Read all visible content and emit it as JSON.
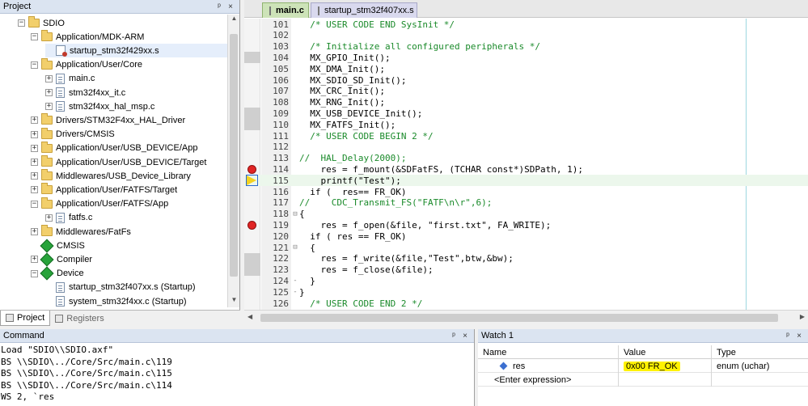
{
  "project_panel": {
    "title": "Project",
    "pin": "ᵖ",
    "close": "×",
    "tree": [
      {
        "label": "SDIO",
        "kind": "folder",
        "indent": 1,
        "exp": "−",
        "sel": false
      },
      {
        "label": "Application/MDK-ARM",
        "kind": "folder",
        "indent": 2,
        "exp": "−",
        "sel": false
      },
      {
        "label": "startup_stm32f429xx.s",
        "kind": "asm",
        "indent": 3,
        "exp": "",
        "sel": true
      },
      {
        "label": "Application/User/Core",
        "kind": "folder",
        "indent": 2,
        "exp": "−",
        "sel": false
      },
      {
        "label": "main.c",
        "kind": "file",
        "indent": 3,
        "exp": "+",
        "sel": false
      },
      {
        "label": "stm32f4xx_it.c",
        "kind": "file",
        "indent": 3,
        "exp": "+",
        "sel": false
      },
      {
        "label": "stm32f4xx_hal_msp.c",
        "kind": "file",
        "indent": 3,
        "exp": "+",
        "sel": false
      },
      {
        "label": "Drivers/STM32F4xx_HAL_Driver",
        "kind": "folder",
        "indent": 2,
        "exp": "+",
        "sel": false
      },
      {
        "label": "Drivers/CMSIS",
        "kind": "folder",
        "indent": 2,
        "exp": "+",
        "sel": false
      },
      {
        "label": "Application/User/USB_DEVICE/App",
        "kind": "folder",
        "indent": 2,
        "exp": "+",
        "sel": false
      },
      {
        "label": "Application/User/USB_DEVICE/Target",
        "kind": "folder",
        "indent": 2,
        "exp": "+",
        "sel": false
      },
      {
        "label": "Middlewares/USB_Device_Library",
        "kind": "folder",
        "indent": 2,
        "exp": "+",
        "sel": false
      },
      {
        "label": "Application/User/FATFS/Target",
        "kind": "folder",
        "indent": 2,
        "exp": "+",
        "sel": false
      },
      {
        "label": "Application/User/FATFS/App",
        "kind": "folder",
        "indent": 2,
        "exp": "−",
        "sel": false
      },
      {
        "label": "fatfs.c",
        "kind": "file",
        "indent": 3,
        "exp": "+",
        "sel": false
      },
      {
        "label": "Middlewares/FatFs",
        "kind": "folder",
        "indent": 2,
        "exp": "+",
        "sel": false
      },
      {
        "label": "CMSIS",
        "kind": "gem",
        "indent": 2,
        "exp": "",
        "sel": false
      },
      {
        "label": "Compiler",
        "kind": "gem",
        "indent": 2,
        "exp": "+",
        "sel": false
      },
      {
        "label": "Device",
        "kind": "gem",
        "indent": 2,
        "exp": "−",
        "sel": false
      },
      {
        "label": "startup_stm32f407xx.s (Startup)",
        "kind": "file",
        "indent": 3,
        "exp": "",
        "sel": false
      },
      {
        "label": "system_stm32f4xx.c (Startup)",
        "kind": "file",
        "indent": 3,
        "exp": "",
        "sel": false
      }
    ],
    "bottom_tabs": [
      "Project",
      "Registers"
    ]
  },
  "editor": {
    "tabs": [
      "main.c",
      "startup_stm32f407xx.s"
    ],
    "lines": [
      {
        "n": "101",
        "text": "  /* USER CODE END SysInit */",
        "cls": "cm",
        "fold": "",
        "mark": "",
        "gray": false
      },
      {
        "n": "102",
        "text": "",
        "cls": "",
        "fold": "",
        "mark": "",
        "gray": false
      },
      {
        "n": "103",
        "text": "  /* Initialize all configured peripherals */",
        "cls": "cm",
        "fold": "",
        "mark": "",
        "gray": false
      },
      {
        "n": "104",
        "text": "  MX_GPIO_Init();",
        "cls": "",
        "fold": "",
        "mark": "",
        "gray": true
      },
      {
        "n": "105",
        "text": "  MX_DMA_Init();",
        "cls": "",
        "fold": "",
        "mark": "",
        "gray": false
      },
      {
        "n": "106",
        "text": "  MX_SDIO_SD_Init();",
        "cls": "",
        "fold": "",
        "mark": "",
        "gray": false
      },
      {
        "n": "107",
        "text": "  MX_CRC_Init();",
        "cls": "",
        "fold": "",
        "mark": "",
        "gray": false
      },
      {
        "n": "108",
        "text": "  MX_RNG_Init();",
        "cls": "",
        "fold": "",
        "mark": "",
        "gray": false
      },
      {
        "n": "109",
        "text": "  MX_USB_DEVICE_Init();",
        "cls": "",
        "fold": "",
        "mark": "",
        "gray": true
      },
      {
        "n": "110",
        "text": "  MX_FATFS_Init();",
        "cls": "",
        "fold": "",
        "mark": "",
        "gray": true
      },
      {
        "n": "111",
        "text": "  /* USER CODE BEGIN 2 */",
        "cls": "cm",
        "fold": "",
        "mark": "",
        "gray": false
      },
      {
        "n": "112",
        "text": "",
        "cls": "",
        "fold": "",
        "mark": "",
        "gray": false
      },
      {
        "n": "113",
        "text": "//  HAL_Delay(2000);",
        "cls": "cm",
        "fold": "",
        "mark": "",
        "gray": false
      },
      {
        "n": "114",
        "text": "    res = f_mount(&SDFatFS, (TCHAR const*)SDPath, 1);",
        "cls": "",
        "fold": "",
        "mark": "bp",
        "gray": false
      },
      {
        "n": "115",
        "text": "    printf(\"Test\");",
        "cls": "",
        "fold": "",
        "mark": "pc",
        "gray": false,
        "current": true
      },
      {
        "n": "116",
        "text": "  if (  res== FR_OK)",
        "cls": "",
        "fold": "",
        "mark": "",
        "gray": false
      },
      {
        "n": "117",
        "text": "//    CDC_Transmit_FS(\"FATF\\n\\r\",6);",
        "cls": "cm",
        "fold": "",
        "mark": "",
        "gray": false
      },
      {
        "n": "118",
        "text": "{",
        "cls": "",
        "fold": "⊟",
        "mark": "",
        "gray": false
      },
      {
        "n": "119",
        "text": "    res = f_open(&file, \"first.txt\", FA_WRITE);",
        "cls": "",
        "fold": "",
        "mark": "bp",
        "gray": false
      },
      {
        "n": "120",
        "text": "  if ( res == FR_OK)",
        "cls": "",
        "fold": "",
        "mark": "",
        "gray": false
      },
      {
        "n": "121",
        "text": "  {",
        "cls": "",
        "fold": "⊟",
        "mark": "",
        "gray": false
      },
      {
        "n": "122",
        "text": "    res = f_write(&file,\"Test\",btw,&bw);",
        "cls": "",
        "fold": "",
        "mark": "",
        "gray": true
      },
      {
        "n": "123",
        "text": "    res = f_close(&file);",
        "cls": "",
        "fold": "",
        "mark": "",
        "gray": true
      },
      {
        "n": "124",
        "text": "  }",
        "cls": "",
        "fold": "-",
        "mark": "",
        "gray": false
      },
      {
        "n": "125",
        "text": "}",
        "cls": "",
        "fold": "-",
        "mark": "",
        "gray": false
      },
      {
        "n": "126",
        "text": "  /* USER CODE END 2 */",
        "cls": "cm",
        "fold": "",
        "mark": "",
        "gray": false
      }
    ]
  },
  "command": {
    "title": "Command",
    "lines": [
      "Load \"SDIO\\\\SDIO.axf\"",
      "BS \\\\SDIO\\../Core/Src/main.c\\119",
      "BS \\\\SDIO\\../Core/Src/main.c\\115",
      "BS \\\\SDIO\\../Core/Src/main.c\\114",
      "WS 2, `res"
    ]
  },
  "watch": {
    "title": "Watch 1",
    "headers": {
      "name": "Name",
      "value": "Value",
      "type": "Type"
    },
    "rows": [
      {
        "name": "res",
        "value": "0x00 FR_OK",
        "type": "enum (uchar)"
      },
      {
        "name": "<Enter expression>",
        "value": "",
        "type": ""
      }
    ]
  },
  "colors": {
    "comment": "#1a8a2a",
    "breakpoint": "#e02424",
    "highlight": "#fff200",
    "tab_active": "#cde3b8"
  }
}
